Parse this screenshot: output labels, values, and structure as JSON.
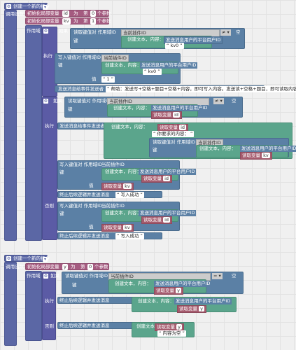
{
  "block1": {
    "header": "创建一个新的指令",
    "call_func": "调用函数",
    "init1": "初始化局部变量",
    "var_id": "id",
    "as": "为",
    "nth": "第",
    "num0": "0",
    "param": "个参数",
    "var_kv": "kv",
    "num1": "1",
    "scope": "作用域",
    "if": "如果",
    "read_kv": "读取键值对 作用域ID",
    "current_scope": "当前插件ID",
    "key": "键",
    "create_text": "创建文本，内容：",
    "sender_user_id": "发送消息用户的平台用户ID",
    "kv0": "kv0",
    "empty": "空",
    "exec": "执行",
    "write_kv": "写入键值对 作用域ID",
    "value": "值",
    "quote_1": "1",
    "send_event_sender": "发送消息给事件发送者",
    "help_text": "帮助：发送写+空格+题目+空格+内容，即可写入内容。发送读+空格+题目，即可读取内容。",
    "read_var": "读取变量",
    "var_id_short": "id",
    "your_content": "你要求的内容：",
    "end_send": "终止后续逻辑并发送消息",
    "write_ok": "写入成功",
    "else": "否则"
  },
  "block2": {
    "header": "创建一个新的指令",
    "call_func": "调用函数",
    "init1": "初始化局部变量",
    "var_y": "y",
    "as": "为",
    "nth": "第",
    "num0": "0",
    "param": "个参数",
    "scope": "作用域",
    "if": "如果",
    "read_kv": "读取键值对 作用域ID",
    "current_scope": "当前插件ID",
    "key": "键",
    "create_text": "创建文本，内容：",
    "sender_user_id": "发送消息用户的平台用户ID",
    "read_var": "读取变量",
    "empty": "空",
    "exec": "执行",
    "end_send": "终止后续逻辑并发送消息",
    "else": "否则",
    "content_empty": "内容为空"
  }
}
